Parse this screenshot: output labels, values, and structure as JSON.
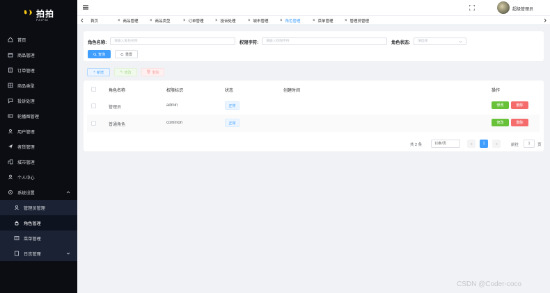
{
  "app": {
    "logo_text": "拍拍",
    "logo_sub": "PAIPAI",
    "user_name": "超级管理员"
  },
  "sidebar": {
    "items": [
      {
        "label": "首页",
        "icon": "home-icon"
      },
      {
        "label": "商品管理",
        "icon": "shop-icon"
      },
      {
        "label": "订单管理",
        "icon": "order-icon"
      },
      {
        "label": "商品类型",
        "icon": "category-icon"
      },
      {
        "label": "投诉处理",
        "icon": "complaint-icon"
      },
      {
        "label": "轮播图管理",
        "icon": "carousel-icon"
      },
      {
        "label": "用户管理",
        "icon": "users-icon"
      },
      {
        "label": "者货管理",
        "icon": "send-icon"
      },
      {
        "label": "城市管理",
        "icon": "city-icon"
      },
      {
        "label": "个人中心",
        "icon": "person-icon"
      },
      {
        "label": "系统设置",
        "icon": "gear-icon"
      }
    ],
    "sub_items": [
      {
        "label": "管理员管理",
        "icon": "user-icon"
      },
      {
        "label": "角色管理",
        "icon": "lock-icon"
      },
      {
        "label": "菜单管理",
        "icon": "menu-icon"
      },
      {
        "label": "日志管理",
        "icon": "log-icon"
      }
    ]
  },
  "tabs": [
    {
      "label": "首页"
    },
    {
      "label": "商品管理"
    },
    {
      "label": "商品类型"
    },
    {
      "label": "订单管理"
    },
    {
      "label": "投诉处理"
    },
    {
      "label": "城市管理"
    },
    {
      "label": "角色管理"
    },
    {
      "label": "菜单管理"
    },
    {
      "label": "管理员管理"
    }
  ],
  "search": {
    "role_name_label": "角色名称:",
    "role_name_placeholder": "请输入角色名称",
    "perm_label": "权限字符:",
    "perm_placeholder": "请输入权限字符",
    "status_label": "角色状态:",
    "status_placeholder": "请选择",
    "query_label": "查询",
    "reset_label": "重置"
  },
  "toolbar": {
    "add_label": "新增",
    "edit_label": "修改",
    "delete_label": "删除"
  },
  "table": {
    "headers": [
      "角色名称",
      "权限标识",
      "状态",
      "创建时间",
      "操作"
    ],
    "rows": [
      {
        "name": "管理员",
        "perm": "admin",
        "status": "正常",
        "created": ""
      },
      {
        "name": "普通角色",
        "perm": "common",
        "status": "正常",
        "created": ""
      }
    ],
    "edit_label": "修改",
    "delete_label": "删除"
  },
  "pagination": {
    "total": "共 2 条",
    "page_size": "10条/页",
    "current_page": "1",
    "goto_label": "前往",
    "goto_value": "1",
    "page_suffix": "页"
  },
  "watermark": "CSDN @Coder-coco",
  "colors": {
    "primary": "#409eff",
    "success": "#67c23a",
    "danger": "#f56c6c",
    "sidebar_bg": "#0b0d12"
  }
}
